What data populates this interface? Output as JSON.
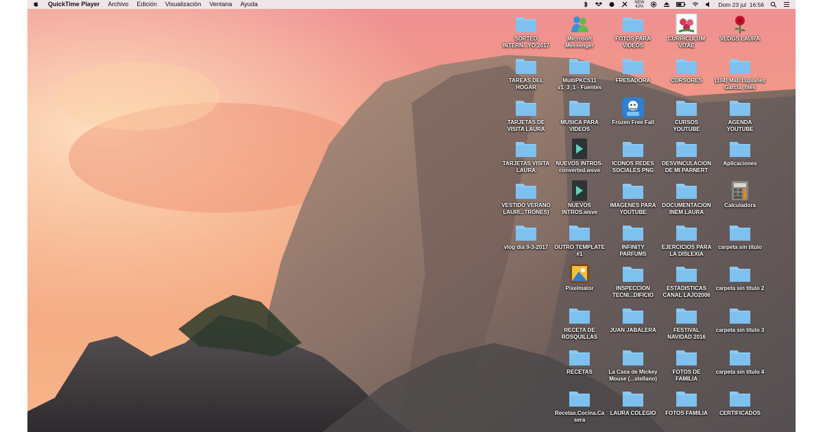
{
  "menubar": {
    "apple": "",
    "app_name": "QuickTime Player",
    "items": [
      "Archivo",
      "Edición",
      "Visualización",
      "Ventana",
      "Ayuda"
    ],
    "status": {
      "battery_top": "NEW",
      "battery_bottom": "42%",
      "datetime": "Dom 23 jul  16:56"
    }
  },
  "colors": {
    "folder": "#7ec0ee",
    "folder_tab": "#8ccaf2",
    "sky_top": "#f49a8c",
    "sky_mid": "#f3a676",
    "rock": "#6f6360"
  },
  "desktop": {
    "icons": [
      {
        "label": "SORTEO\nINTERN...YO 2017",
        "kind": "folder"
      },
      {
        "label": "Microsoft\nMessenger",
        "kind": "messenger-icon"
      },
      {
        "label": "FOTOS PARA\nVIDEOS",
        "kind": "folder"
      },
      {
        "label": "CURRICULUM\nVITAE",
        "kind": "flowers-icon"
      },
      {
        "label": "VLOGS LAURA",
        "kind": "rose-icon"
      },
      {
        "label": "TAREAS DEL\nHOGAR",
        "kind": "folder"
      },
      {
        "label": "MultiPKCS11\nv1_3_1 - Fuentes",
        "kind": "folder"
      },
      {
        "label": "FRESADORA",
        "kind": "folder"
      },
      {
        "label": "CURSORES",
        "kind": "folder"
      },
      {
        "label": "(104) Mati Lupiañez\nGarcia_files",
        "kind": "folder"
      },
      {
        "label": "TARJETAS DE\nVISITA LAURA",
        "kind": "folder"
      },
      {
        "label": "MUSICA PARA\nVIDEOS",
        "kind": "folder"
      },
      {
        "label": "Frozen Free Fall",
        "kind": "frozen-icon"
      },
      {
        "label": "CURSOS\nYOUTUBE",
        "kind": "folder"
      },
      {
        "label": "AGENDA\nYOUTUBE",
        "kind": "folder"
      },
      {
        "label": "TARJETAS VISITA\nLAURA",
        "kind": "folder"
      },
      {
        "label": "NUEVOS INTROS-\nconverted.wsve",
        "kind": "wsve-icon"
      },
      {
        "label": "ICONOS REDES\nSOCIALES PNG",
        "kind": "folder"
      },
      {
        "label": "DESVINCULACION\nDE MI PARNERT",
        "kind": "folder"
      },
      {
        "label": "Aplicaciones",
        "kind": "folder"
      },
      {
        "label": "VESTIDO VERANO\nLAURI...TRONES)",
        "kind": "folder"
      },
      {
        "label": "NUEVOS\nINTROS.wsve",
        "kind": "wsve-icon"
      },
      {
        "label": "IMAGENES PARA\nYOUTUBE",
        "kind": "folder"
      },
      {
        "label": "DOCUMENTACION\nINEM LAURA",
        "kind": "folder"
      },
      {
        "label": "Calculadora",
        "kind": "calculator-icon"
      },
      {
        "label": "vlog dia 9-3-2017",
        "kind": "folder"
      },
      {
        "label": "OUTRO TEMPLATE\n#1",
        "kind": "folder"
      },
      {
        "label": "INFINITY\nPARFUMS",
        "kind": "folder"
      },
      {
        "label": "EJERCICIOS PARA\nLA DISLEXIA",
        "kind": "folder"
      },
      {
        "label": "carpeta sin título",
        "kind": "folder"
      },
      {
        "label": "Pixelmator",
        "kind": "pixelmator-icon"
      },
      {
        "label": "INSPECCION\nTECNI...DIFICIO",
        "kind": "folder"
      },
      {
        "label": "ESTADISTICAS\nCANAL LAJO2006",
        "kind": "folder"
      },
      {
        "label": "carpeta sin título 2",
        "kind": "folder"
      },
      {
        "label": "RECETA DE\nROSQUILLAS",
        "kind": "folder"
      },
      {
        "label": "JUAN JABALERA",
        "kind": "folder"
      },
      {
        "label": "FESTIVAL\nNAVIDAD 2016",
        "kind": "folder"
      },
      {
        "label": "carpeta sin título 3",
        "kind": "folder"
      },
      {
        "label": "RECETAS",
        "kind": "folder"
      },
      {
        "label": "La Casa de Mickey\nMouse (...stellano)",
        "kind": "folder"
      },
      {
        "label": "FOTOS DE\nFAMILIA",
        "kind": "folder"
      },
      {
        "label": "carpeta sin título 4",
        "kind": "folder"
      },
      {
        "label": "Recetas.Cocina.Ca\nsera",
        "kind": "folder"
      },
      {
        "label": "LAURA COLEGIO",
        "kind": "folder"
      },
      {
        "label": "FOTOS FAMILIA",
        "kind": "folder"
      },
      {
        "label": "CERTIFICADOS",
        "kind": "folder"
      }
    ]
  }
}
